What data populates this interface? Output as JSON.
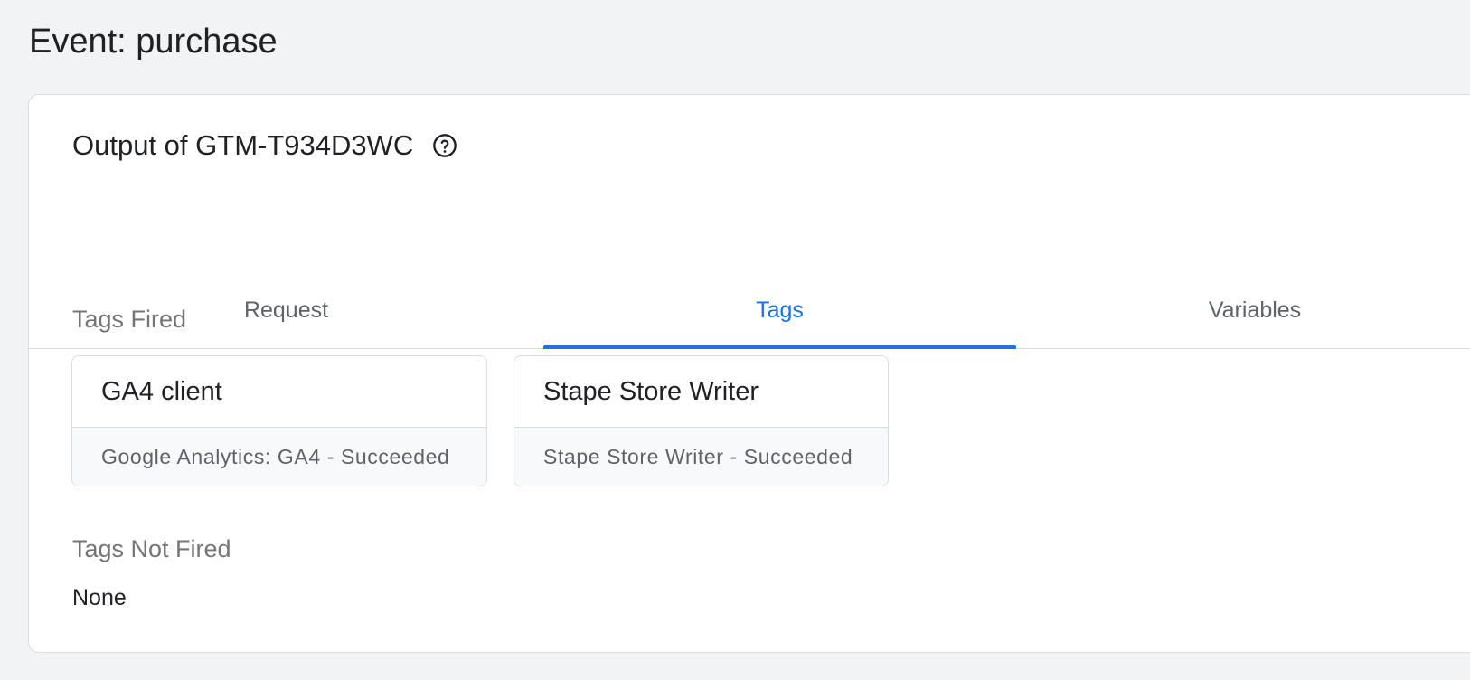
{
  "page": {
    "title": "Event: purchase"
  },
  "output": {
    "title": "Output of GTM-T934D3WC",
    "help_icon": "help-circle-icon"
  },
  "tabs": [
    {
      "label": "Request",
      "active": false
    },
    {
      "label": "Tags",
      "active": true
    },
    {
      "label": "Variables",
      "active": false
    }
  ],
  "tags_fired": {
    "heading": "Tags Fired",
    "items": [
      {
        "name": "GA4 client",
        "status": "Google Analytics: GA4 - Succeeded"
      },
      {
        "name": "Stape Store Writer",
        "status": "Stape Store Writer - Succeeded"
      }
    ]
  },
  "tags_not_fired": {
    "heading": "Tags Not Fired",
    "value": "None"
  },
  "colors": {
    "accent": "#1a73e8",
    "background": "#f1f3f4",
    "card": "#ffffff",
    "muted_text": "#5f6368"
  }
}
